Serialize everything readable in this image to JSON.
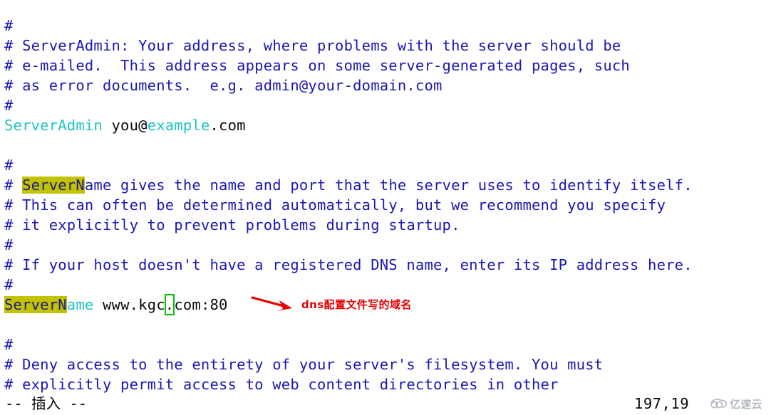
{
  "editor": {
    "name": "vim-text-editor",
    "background": "#ffffff",
    "comment_color": "#1a17b5",
    "keyword_color": "#1cc4c4",
    "plain_color": "#0a0a0a",
    "search_highlight_bg": "#c2c200",
    "cursor_outline_color": "#00c000",
    "lines": [
      {
        "id": 0,
        "segments": [
          {
            "t": "#",
            "c": "cmt"
          }
        ]
      },
      {
        "id": 1,
        "segments": [
          {
            "t": "# ServerAdmin: Your address, where problems with the server should be",
            "c": "cmt"
          }
        ]
      },
      {
        "id": 2,
        "segments": [
          {
            "t": "# e-mailed.  This address appears on some server-generated pages, such",
            "c": "cmt"
          }
        ]
      },
      {
        "id": 3,
        "segments": [
          {
            "t": "# as error documents.  e.g. admin@your-domain.com",
            "c": "cmt"
          }
        ]
      },
      {
        "id": 4,
        "segments": [
          {
            "t": "#",
            "c": "cmt"
          }
        ]
      },
      {
        "id": 5,
        "segments": [
          {
            "t": "ServerAdmin",
            "c": "kw"
          },
          {
            "t": " you@",
            "c": "plain"
          },
          {
            "t": "example",
            "c": "kw"
          },
          {
            "t": ".com",
            "c": "plain"
          }
        ]
      },
      {
        "id": 6,
        "segments": []
      },
      {
        "id": 7,
        "segments": [
          {
            "t": "#",
            "c": "cmt"
          }
        ]
      },
      {
        "id": 8,
        "segments": [
          {
            "t": "# ",
            "c": "cmt"
          },
          {
            "t": "ServerN",
            "c": "hl"
          },
          {
            "t": "ame gives the name and port that the server uses to identify itself.",
            "c": "cmt"
          }
        ]
      },
      {
        "id": 9,
        "segments": [
          {
            "t": "# This can often be determined automatically, but we recommend you specify",
            "c": "cmt"
          }
        ]
      },
      {
        "id": 10,
        "segments": [
          {
            "t": "# it explicitly to prevent problems during startup.",
            "c": "cmt"
          }
        ]
      },
      {
        "id": 11,
        "segments": [
          {
            "t": "#",
            "c": "cmt"
          }
        ]
      },
      {
        "id": 12,
        "segments": [
          {
            "t": "# If your host doesn't have a registered DNS name, enter its IP address here.",
            "c": "cmt"
          }
        ]
      },
      {
        "id": 13,
        "segments": [
          {
            "t": "#",
            "c": "cmt"
          }
        ]
      },
      {
        "id": 14,
        "segments": [
          {
            "t": "ServerN",
            "c": "hl"
          },
          {
            "t": "ame",
            "c": "kw"
          },
          {
            "t": " www.kgc",
            "c": "plain"
          },
          {
            "t": ".",
            "c": "cursor"
          },
          {
            "t": "com:80",
            "c": "plain"
          }
        ]
      },
      {
        "id": 15,
        "segments": []
      },
      {
        "id": 16,
        "segments": [
          {
            "t": "#",
            "c": "cmt"
          }
        ]
      },
      {
        "id": 17,
        "segments": [
          {
            "t": "# Deny access to the entirety of your server's filesystem. You must",
            "c": "cmt"
          }
        ]
      },
      {
        "id": 18,
        "segments": [
          {
            "t": "# explicitly permit access to web content directories in other",
            "c": "cmt"
          }
        ]
      }
    ]
  },
  "annotation": {
    "arrow_color": "#e60000",
    "text": "dns配置文件写的域名"
  },
  "status": {
    "mode": "-- 插入 --",
    "position": "197,19"
  },
  "watermark": {
    "text": "亿速云",
    "logo": "cloud-icon",
    "color": "#b0b5bf"
  }
}
